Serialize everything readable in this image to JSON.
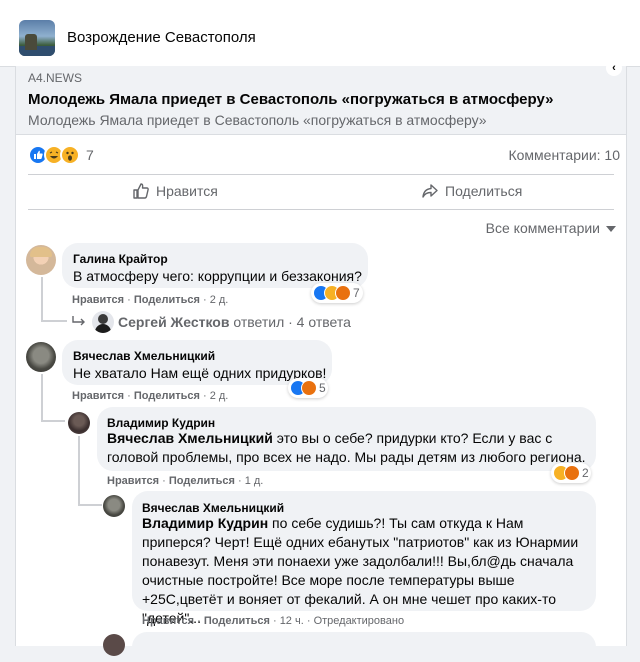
{
  "group": {
    "name": "Возрождение Севастополя"
  },
  "link_preview": {
    "source": "A4.NEWS",
    "title": "Молодежь Ямала приедет в Севастополь «погружаться в атмосферу»",
    "description": "Молодежь Ямала приедет в Севастополь «погружаться в атмосферу»",
    "close_glyph": "‹"
  },
  "post_stats": {
    "reactions": "7",
    "comments": "Комментарии: 10"
  },
  "actions": {
    "like": "Нравится",
    "share": "Поделиться"
  },
  "comments_filter": {
    "label": "Все комментарии"
  },
  "comments": [
    {
      "author": "Галина Крайтор",
      "text": "В атмосферу чего: коррупции и беззакония?",
      "like": "Нравится",
      "reply": "Поделиться",
      "time": "2 д.",
      "reactions": "7",
      "replies_summary": {
        "name": "Сергей Жестков",
        "suffix": "ответил · 4 ответа"
      }
    },
    {
      "author": "Вячеслав Хмельницкий",
      "text": "Не хватало Нам ещё одних придурков!",
      "like": "Нравится",
      "reply": "Поделиться",
      "time": "2 д.",
      "reactions": "5",
      "replies": [
        {
          "author": "Владимир Кудрин",
          "mention": "Вячеслав Хмельницкий",
          "text": " это вы о себе? придурки кто? Если у вас с головой проблемы, про всех не надо. Мы рады детям из любого региона.",
          "like": "Нравится",
          "reply": "Поделиться",
          "time": "1 д.",
          "reactions": "2"
        },
        {
          "author": "Вячеслав Хмельницкий",
          "mention": "Владимир Кудрин",
          "text": " по себе судишь?! Ты сам откуда к Нам приперся? Черт! Ещё одних ебанутых \"патриотов\" как из Юнармии понавезут. Меня эти понаехи уже задолбали!!! Вы,бл@дь сначала очистные постройте! Все море после температуры выше +25С,цветёт и воняет от фекалий. А он мне чешет про каких-то \"детей\"...",
          "like": "Нравится",
          "reply": "Поделиться",
          "time": "12 ч.",
          "edited": "Отредактировано"
        }
      ]
    }
  ],
  "colors": {
    "accent": "#1877f2",
    "secondary_text": "#65676b",
    "bubble": "#f0f2f5"
  }
}
